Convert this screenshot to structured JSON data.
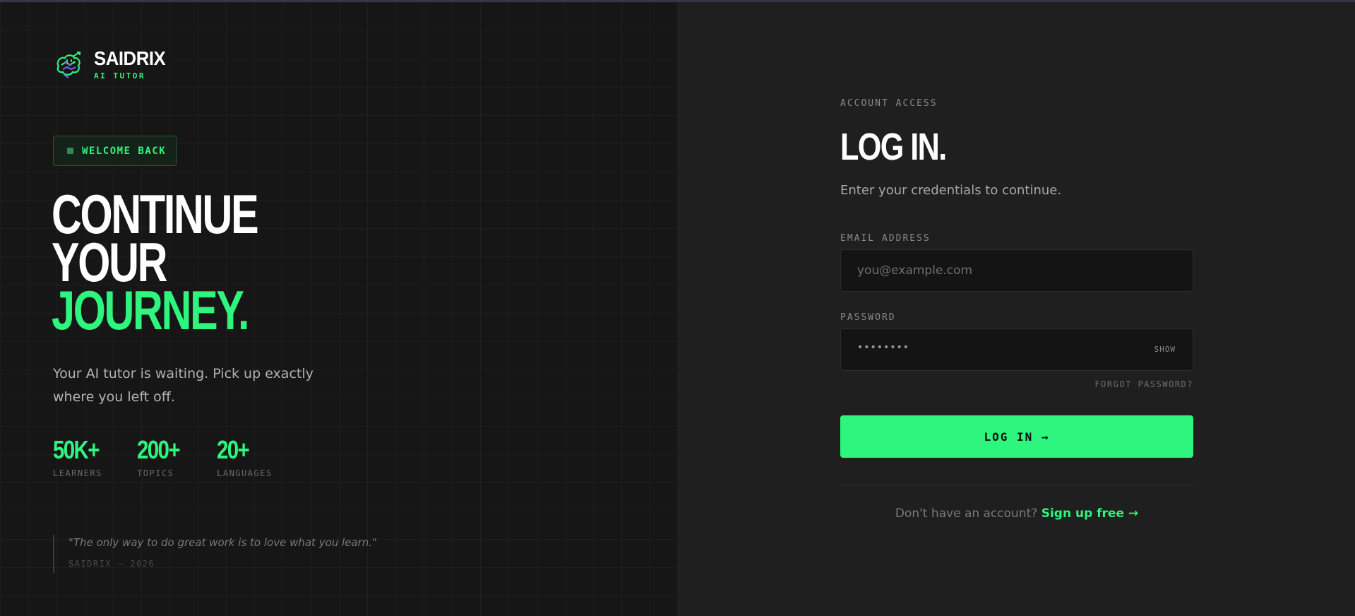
{
  "brand": {
    "name": "SAIDRIX",
    "tagline": "AI TUTOR",
    "logo_icon": "brain-circuit-icon"
  },
  "hero": {
    "badge": "WELCOME BACK",
    "headline_line1": "CONTINUE",
    "headline_line2": "YOUR",
    "headline_line3": "JOURNEY.",
    "subtitle": "Your AI tutor is waiting. Pick up exactly where you left off."
  },
  "stats": [
    {
      "value": "50K+",
      "label": "LEARNERS"
    },
    {
      "value": "200+",
      "label": "TOPICS"
    },
    {
      "value": "20+",
      "label": "LANGUAGES"
    }
  ],
  "quote": {
    "text": "\"The only way to do great work is to love what you learn.\"",
    "attribution": "SAIDRIX — 2026"
  },
  "form": {
    "kicker": "ACCOUNT ACCESS",
    "title": "LOG IN.",
    "description": "Enter your credentials to continue.",
    "email_label": "EMAIL ADDRESS",
    "email_placeholder": "you@example.com",
    "password_label": "PASSWORD",
    "password_value": "••••••••",
    "show_label": "SHOW",
    "forgot_label": "FORGOT PASSWORD?",
    "submit_label": "LOG IN →",
    "signup_question": "Don't have an account?",
    "signup_link": "Sign up free →"
  },
  "colors": {
    "accent": "#2ef57e",
    "left_bg": "#161616",
    "right_bg": "#1f1f1f",
    "field_bg": "#141414"
  }
}
